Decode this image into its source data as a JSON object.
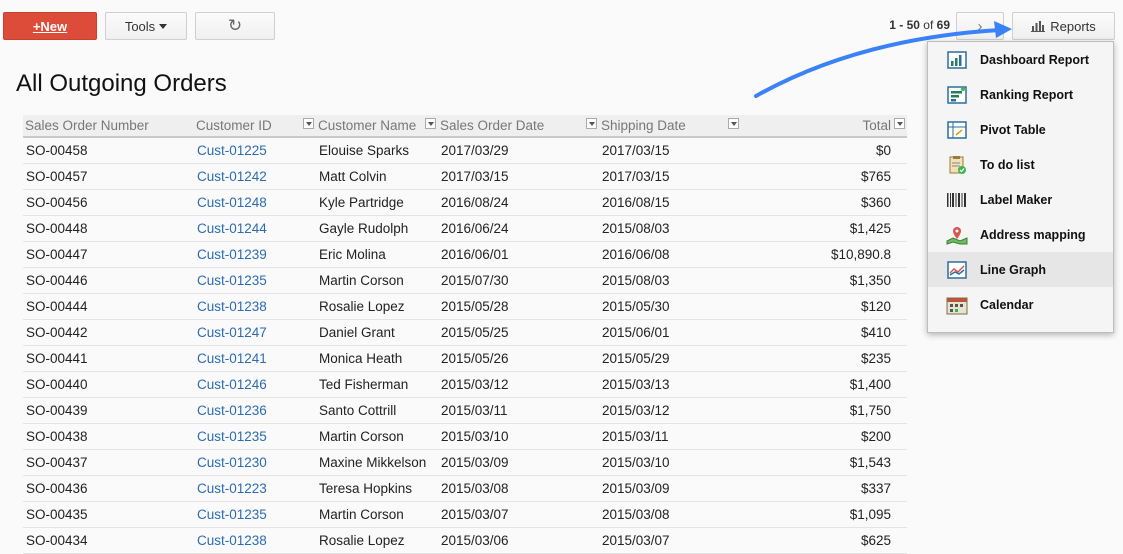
{
  "toolbar": {
    "new_label": "+New",
    "tools_label": "Tools",
    "refresh_glyph": "↻",
    "next_glyph": "›",
    "reports_label": "Reports"
  },
  "pager": {
    "range": "1 - 50",
    "of_label": "of",
    "total": "69"
  },
  "page_title": "All Outgoing Orders",
  "table": {
    "columns": [
      "Sales Order Number",
      "Customer ID",
      "Customer Name",
      "Sales Order Date",
      "Shipping Date",
      "Total"
    ],
    "rows": [
      [
        "SO-00458",
        "Cust-01225",
        "Elouise Sparks",
        "2017/03/29",
        "2017/03/15",
        "$0"
      ],
      [
        "SO-00457",
        "Cust-01242",
        "Matt Colvin",
        "2017/03/15",
        "2017/03/15",
        "$765"
      ],
      [
        "SO-00456",
        "Cust-01248",
        "Kyle Partridge",
        "2016/08/24",
        "2016/08/15",
        "$360"
      ],
      [
        "SO-00448",
        "Cust-01244",
        "Gayle Rudolph",
        "2016/06/24",
        "2015/08/03",
        "$1,425"
      ],
      [
        "SO-00447",
        "Cust-01239",
        "Eric Molina",
        "2016/06/01",
        "2016/06/08",
        "$10,890.8"
      ],
      [
        "SO-00446",
        "Cust-01235",
        "Martin Corson",
        "2015/07/30",
        "2015/08/03",
        "$1,350"
      ],
      [
        "SO-00444",
        "Cust-01238",
        "Rosalie Lopez",
        "2015/05/28",
        "2015/05/30",
        "$120"
      ],
      [
        "SO-00442",
        "Cust-01247",
        "Daniel Grant",
        "2015/05/25",
        "2015/06/01",
        "$410"
      ],
      [
        "SO-00441",
        "Cust-01241",
        "Monica Heath",
        "2015/05/26",
        "2015/05/29",
        "$235"
      ],
      [
        "SO-00440",
        "Cust-01246",
        "Ted Fisherman",
        "2015/03/12",
        "2015/03/13",
        "$1,400"
      ],
      [
        "SO-00439",
        "Cust-01236",
        "Santo Cottrill",
        "2015/03/11",
        "2015/03/12",
        "$1,750"
      ],
      [
        "SO-00438",
        "Cust-01235",
        "Martin Corson",
        "2015/03/10",
        "2015/03/11",
        "$200"
      ],
      [
        "SO-00437",
        "Cust-01230",
        "Maxine Mikkelson",
        "2015/03/09",
        "2015/03/10",
        "$1,543"
      ],
      [
        "SO-00436",
        "Cust-01223",
        "Teresa Hopkins",
        "2015/03/08",
        "2015/03/09",
        "$337"
      ],
      [
        "SO-00435",
        "Cust-01235",
        "Martin Corson",
        "2015/03/07",
        "2015/03/08",
        "$1,095"
      ],
      [
        "SO-00434",
        "Cust-01238",
        "Rosalie Lopez",
        "2015/03/06",
        "2015/03/07",
        "$625"
      ]
    ]
  },
  "reports_menu": {
    "items": [
      {
        "label": "Dashboard Report",
        "icon": "dashboard-report-icon"
      },
      {
        "label": "Ranking Report",
        "icon": "ranking-report-icon"
      },
      {
        "label": "Pivot Table",
        "icon": "pivot-table-icon"
      },
      {
        "label": "To do list",
        "icon": "todo-list-icon"
      },
      {
        "label": "Label Maker",
        "icon": "barcode-icon"
      },
      {
        "label": "Address mapping",
        "icon": "map-icon"
      },
      {
        "label": "Line Graph",
        "icon": "line-graph-icon"
      },
      {
        "label": "Calendar",
        "icon": "calendar-icon"
      }
    ],
    "highlighted_item": "Line Graph"
  },
  "colors": {
    "new_button": "#dd4b39",
    "link": "#2c6bb3",
    "annotation_arrow": "#3b82f6"
  }
}
